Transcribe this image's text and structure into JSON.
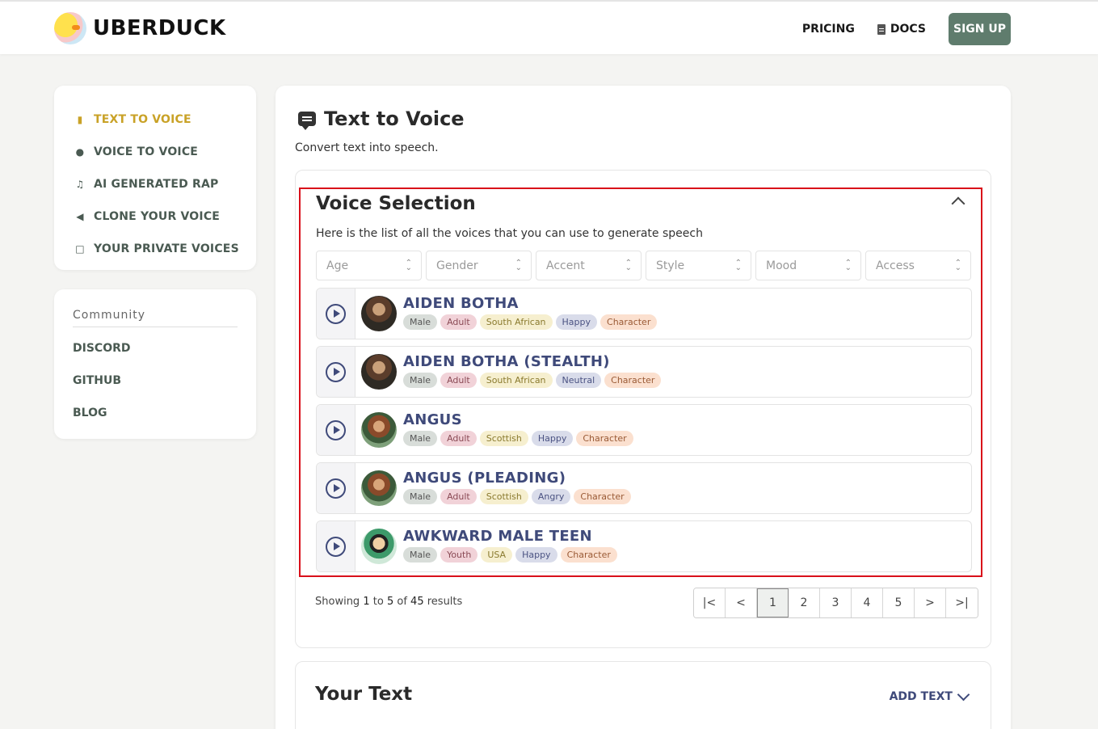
{
  "brand": {
    "name": "UBERDUCK"
  },
  "nav": {
    "pricing": "PRICING",
    "docs": "DOCS",
    "signup": "SIGN UP"
  },
  "sidebar": {
    "items": [
      {
        "label": "TEXT TO VOICE",
        "icon": "chat-icon",
        "active": true
      },
      {
        "label": "VOICE TO VOICE",
        "icon": "microphone-icon",
        "active": false
      },
      {
        "label": "AI GENERATED RAP",
        "icon": "music-note-icon",
        "active": false
      },
      {
        "label": "CLONE YOUR VOICE",
        "icon": "speaker-icon",
        "active": false
      },
      {
        "label": "YOUR PRIVATE VOICES",
        "icon": "lock-icon",
        "active": false
      }
    ],
    "community": {
      "title": "Community",
      "links": [
        "DISCORD",
        "GITHUB",
        "BLOG"
      ]
    }
  },
  "main": {
    "title": "Text to Voice",
    "subtitle": "Convert text into speech.",
    "voice_selection": {
      "title": "Voice Selection",
      "description": "Here is the list of all the voices that you can use to generate speech",
      "filters": [
        {
          "placeholder": "Age"
        },
        {
          "placeholder": "Gender"
        },
        {
          "placeholder": "Accent"
        },
        {
          "placeholder": "Style"
        },
        {
          "placeholder": "Mood"
        },
        {
          "placeholder": "Access"
        }
      ],
      "voices": [
        {
          "name": "AIDEN BOTHA",
          "tags": [
            "Male",
            "Adult",
            "South African",
            "Happy",
            "Character"
          ]
        },
        {
          "name": "AIDEN BOTHA (STEALTH)",
          "tags": [
            "Male",
            "Adult",
            "South African",
            "Neutral",
            "Character"
          ]
        },
        {
          "name": "ANGUS",
          "tags": [
            "Male",
            "Adult",
            "Scottish",
            "Happy",
            "Character"
          ]
        },
        {
          "name": "ANGUS (PLEADING)",
          "tags": [
            "Male",
            "Adult",
            "Scottish",
            "Angry",
            "Character"
          ]
        },
        {
          "name": "AWKWARD MALE TEEN",
          "tags": [
            "Male",
            "Youth",
            "USA",
            "Happy",
            "Character"
          ]
        }
      ],
      "results": {
        "prefix": "Showing",
        "from": "1",
        "to_word": "to",
        "to": "5",
        "of_word": "of",
        "total": "45",
        "suffix": "results"
      },
      "pagination": {
        "first": "|<",
        "prev": "<",
        "pages": [
          "1",
          "2",
          "3",
          "4",
          "5"
        ],
        "current": "1",
        "next": ">",
        "last": ">|"
      }
    },
    "your_text": {
      "title": "Your Text",
      "add_label": "ADD TEXT"
    }
  },
  "colors": {
    "accent_active": "#c9a227",
    "signup_bg": "#5f7c6d",
    "voice_name": "#3f4a7a",
    "highlight_border": "#d9101a"
  }
}
